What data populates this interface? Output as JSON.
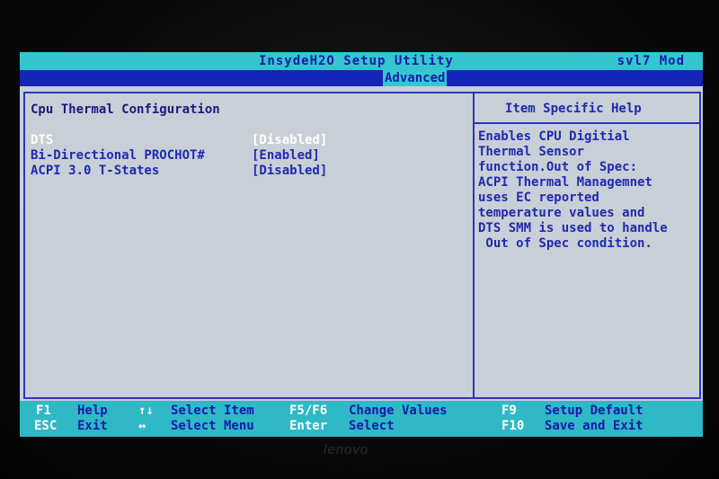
{
  "header": {
    "title": "InsydeH2O Setup Utility",
    "model": "svl7 Mod",
    "active_tab": "Advanced"
  },
  "main": {
    "section_title": "Cpu Thermal Configuration",
    "options": [
      {
        "label": "DTS",
        "value": "[Disabled]",
        "selected": true
      },
      {
        "label": "Bi-Directional PROCHOT#",
        "value": "[Enabled]",
        "selected": false
      },
      {
        "label": "ACPI 3.0 T-States",
        "value": "[Disabled]",
        "selected": false
      }
    ]
  },
  "help": {
    "title": "Item Specific Help",
    "lines": [
      "Enables CPU Digitial",
      "Thermal Sensor",
      "function.Out of Spec:",
      "ACPI Thermal Managemnet",
      "uses EC reported",
      "temperature values and",
      "DTS SMM is used to handle",
      " Out of Spec condition."
    ]
  },
  "footer": {
    "f1_key": "F1",
    "f1_desc": "Help",
    "esc_key": "ESC",
    "esc_desc": "Exit",
    "updown_key": "↑↓",
    "updown_desc": "Select Item",
    "leftright_key": "↔",
    "leftright_desc": "Select Menu",
    "f5f6_key": "F5/F6",
    "f5f6_desc": "Change Values",
    "enter_key": "Enter",
    "enter_desc": "Select",
    "f9_key": "F9",
    "f9_desc": "Setup Default",
    "f10_key": "F10",
    "f10_desc": "Save and Exit"
  },
  "bezel": {
    "brand": "lenovo"
  }
}
